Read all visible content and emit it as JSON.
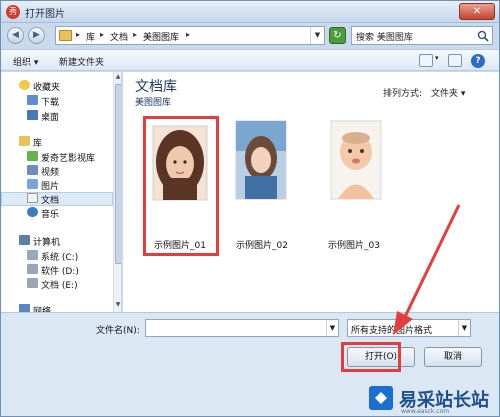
{
  "window": {
    "title": "打开图片",
    "close_glyph": "✕"
  },
  "address": {
    "back_glyph": "◀",
    "forward_glyph": "▶",
    "crumbs": [
      "库",
      "文档",
      "美图图库"
    ],
    "search_placeholder": "搜索 美图图库"
  },
  "toolbar": {
    "organize_label": "组织 ▾",
    "new_folder_label": "新建文件夹",
    "help_glyph": "?"
  },
  "nav": {
    "items": [
      {
        "label": "收藏夹",
        "icon": "star-icon"
      },
      {
        "label": "下载",
        "icon": "download-folder-icon"
      },
      {
        "label": "桌面",
        "icon": "desktop-icon"
      },
      {
        "label": "库",
        "icon": "library-icon"
      },
      {
        "label": "爱奇艺影视库",
        "icon": "video-library-icon"
      },
      {
        "label": "视频",
        "icon": "video-icon"
      },
      {
        "label": "图片",
        "icon": "picture-icon"
      },
      {
        "label": "文档",
        "icon": "document-icon",
        "selected": true
      },
      {
        "label": "音乐",
        "icon": "music-icon"
      },
      {
        "label": "计算机",
        "icon": "computer-icon"
      },
      {
        "label": "系统 (C:)",
        "icon": "drive-icon"
      },
      {
        "label": "软件 (D:)",
        "icon": "drive-icon"
      },
      {
        "label": "文档 (E:)",
        "icon": "drive-icon"
      },
      {
        "label": "网络",
        "icon": "network-icon"
      }
    ]
  },
  "content": {
    "library_title": "文档库",
    "library_subtitle": "美图图库",
    "arrange_label": "排列方式:",
    "arrange_value": "文件夹 ▾",
    "files": [
      {
        "name": "示例图片_01",
        "highlighted": true
      },
      {
        "name": "示例图片_02",
        "highlighted": false
      },
      {
        "name": "示例图片_03",
        "highlighted": false
      }
    ]
  },
  "footer": {
    "filename_label": "文件名(N):",
    "filename_value": "",
    "filetype_value": "所有支持的图片格式",
    "open_label": "打开(O)",
    "cancel_label": "取消"
  },
  "watermark": {
    "text": "易采站长站",
    "url": "www.easck.com"
  },
  "colors": {
    "highlight": "#e33d3d",
    "library_title": "#1f3a67"
  }
}
